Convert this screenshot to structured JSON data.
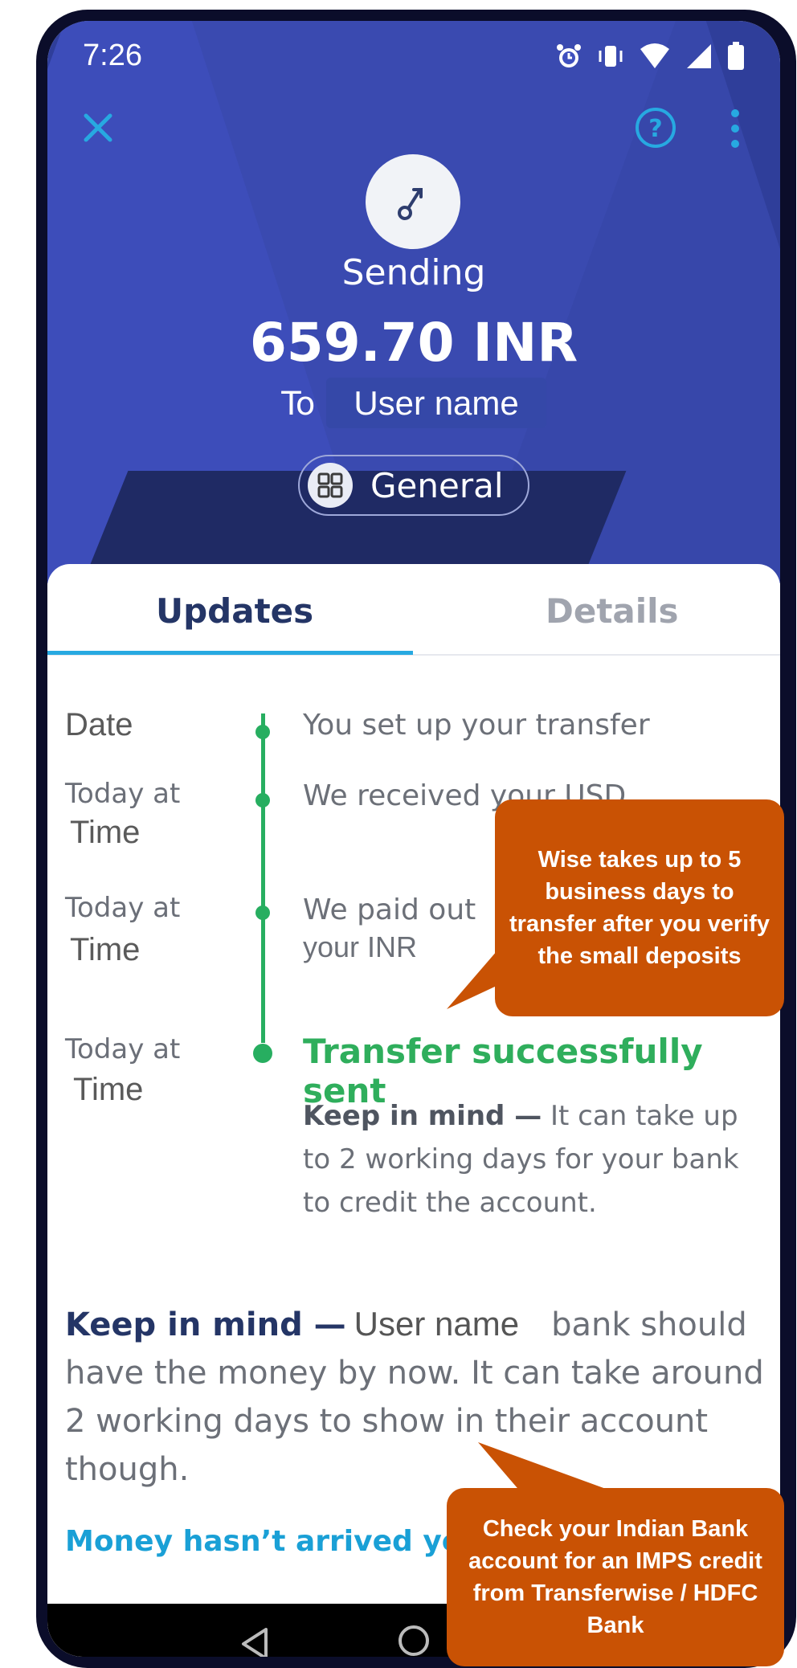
{
  "status_bar": {
    "time": "7:26"
  },
  "header": {
    "sending_label": "Sending",
    "amount": "659.70 INR",
    "to_label": "To",
    "recipient": "User name",
    "category": "General"
  },
  "tabs": [
    {
      "label": "Updates",
      "active": true
    },
    {
      "label": "Details",
      "active": false
    }
  ],
  "timeline": [
    {
      "date": "Date",
      "time": "",
      "text": "You set up your transfer"
    },
    {
      "date": "Today at",
      "time": "Time",
      "text": "We received your USD"
    },
    {
      "date": "Today at",
      "time": "Time",
      "text_line1": "We paid out",
      "text_line2": "your INR"
    },
    {
      "date": "Today at",
      "time": "Time",
      "text": "Transfer successfully sent"
    }
  ],
  "keep_in_mind_inline": {
    "bold": "Keep in mind —",
    "text": "It can take up to 2 working days for your bank to credit the account."
  },
  "note": {
    "bold": "Keep in mind —",
    "name": "User name",
    "word": "bank",
    "text": "should have the money by now. It can take around 2 working days to show in their account though."
  },
  "link": "Money hasn’t arrived yet?",
  "callouts": {
    "first": "Wise takes up to 5 business days to transfer after you verify the small deposits",
    "second": "Check your Indian Bank account for an IMPS credit from Transferwise / HDFC Bank"
  },
  "colors": {
    "header_blue": "#2f3e9a",
    "accent": "#27a9e1",
    "success": "#2fae5c",
    "callout": "#c95204"
  }
}
